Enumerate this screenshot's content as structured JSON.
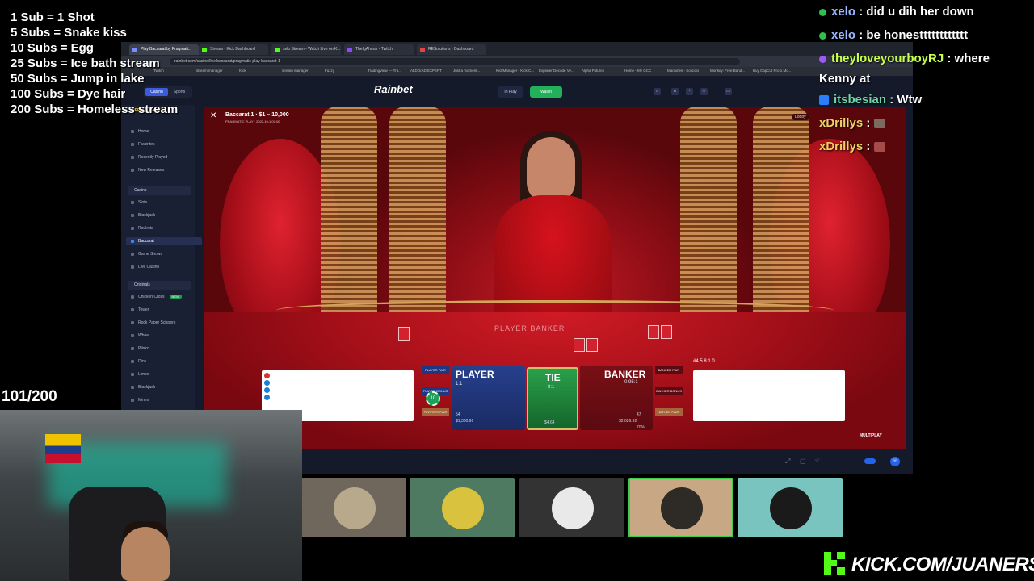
{
  "stream_overlay": {
    "sub_goals": [
      "1 Sub = 1 Shot",
      "5 Subs = Snake kiss",
      "10 Subs = Egg",
      "25 Subs = Ice bath stream",
      "50 Subs = Jump in lake",
      "100 Subs = Dye hair",
      "200 Subs = Homeless stream"
    ],
    "sub_counter": "101/200",
    "watermark": "KICK.COM/JUANERSSS"
  },
  "chat": {
    "messages": [
      {
        "user": "xelo",
        "text": ": did u dih her down",
        "user_color": "#9ab8ff",
        "badge": "#2fbf4a"
      },
      {
        "user": "xelo",
        "text": ": be honestttttttttttt",
        "user_color": "#9ab8ff",
        "badge": "#2fbf4a"
      },
      {
        "user": "theyloveyourboyRJ",
        "text": ": where",
        "user_color": "#c8ff4a",
        "badge": "#9b59f5"
      },
      {
        "user": "",
        "text": "Kenny at",
        "user_color": "#ffffff",
        "badge": ""
      },
      {
        "user": "itsbesian",
        "text": ": Wtw",
        "user_color": "#6fd6a6",
        "badge": "#2b7fff"
      },
      {
        "user": "xDrillys",
        "text": ":",
        "user_color": "#f0d060",
        "badge": ""
      },
      {
        "user": "xDrillys",
        "text": ":",
        "user_color": "#f0d060",
        "badge": ""
      }
    ]
  },
  "browser": {
    "tabs": [
      {
        "label": "Play Baccarat by Pragmati...",
        "color": "#7a8cff"
      },
      {
        "label": "Stream - Kick Dashboard",
        "color": "#53fc18"
      },
      {
        "label": "xelo Stream - Watch Live on K...",
        "color": "#53fc18"
      },
      {
        "label": "TheIgAhmar - Twitch",
        "color": "#9146ff"
      },
      {
        "label": "RESolutions - Dashboard",
        "color": "#e24545"
      }
    ],
    "url": "rainbet.com/casino/live/baccarat/pragmatic-play-baccarat-1",
    "bookmarks": [
      "Twitch",
      "stream manager",
      "Kick",
      "stream manager",
      "Fuzzy",
      "TradingView — Tra...",
      "ALDO/AD EXPERT",
      "Just a moment...",
      "KickManager - Kick C...",
      "Explorer Decode Ve...",
      "Alpha Futures",
      "Home - My GCC",
      "Machines - Solicolo",
      "Monkey: Free Band...",
      "Buy CapCut Pro 1 Mo..."
    ]
  },
  "site": {
    "logo": "Rainbet",
    "toggle": [
      "Casino",
      "Sports"
    ],
    "in_play": "In Play",
    "wallet": "Wallet",
    "sidebar": {
      "raffle": "WEEKLY RAFFLE",
      "items_top": [
        "Home",
        "Favorites",
        "Recently Played",
        "New Releases"
      ],
      "casino_head": "Casino",
      "casino_items": [
        "Slots",
        "Blackjack",
        "Roulette",
        "Baccarat",
        "Game Shows",
        "Live Casino"
      ],
      "originals_head": "Originals",
      "originals_items": [
        "Chicken Cross",
        "Tower",
        "Rock Paper Scissors",
        "Wheel",
        "Plinko",
        "Dice",
        "Limbo",
        "Blackjack",
        "Mines"
      ],
      "new_badge": "NEW"
    }
  },
  "game": {
    "title": "Baccarat 1 · $1 – 10,000",
    "provider": "PRAGMATIC PLAY · 2020-10-1 00:00",
    "lobby": "Lobby",
    "table_text": "PLAYER  BANKER",
    "player": {
      "label": "PLAYER",
      "odds": "1:1",
      "count": "54",
      "amount": "$1,300.96"
    },
    "tie": {
      "label": "TIE",
      "odds": "8:1",
      "amount": "$4.64"
    },
    "banker": {
      "label": "BANKER",
      "odds": "0.95:1",
      "count": "47",
      "amount": "$2,026.92",
      "pct": "70%"
    },
    "side_bets": {
      "player_pair": "PLAYER PAIR",
      "player_bonus": "PLAYER BONUS",
      "perfect_pair": "PERFECT PAIR",
      "banker_pair": "BANKER PAIR",
      "banker_bonus": "BANKER BONUS",
      "either_pair": "EITHER PAIR"
    },
    "chip_value": "10",
    "stats": "#4  5  8  1  0",
    "multiplay": "MULTIPLAY"
  },
  "colors": {
    "kick_green": "#53fc18",
    "wallet_green": "#22b05a",
    "player_blue": "#27408d",
    "tie_green": "#29a04a",
    "banker_red": "#7a0f16"
  },
  "participants": [
    {
      "bg": "#6f675c",
      "ava": "#b8a98c",
      "icon": "group-photo-avatar"
    },
    {
      "bg": "#4e7a62",
      "ava": "#d8c23e",
      "icon": "person-avatar"
    },
    {
      "bg": "#333333",
      "ava": "#e9e9e9",
      "icon": "fish-avatar"
    },
    {
      "bg": "#c8a784",
      "ava": "#2e2a26",
      "icon": "baby-avatar"
    },
    {
      "bg": "#79c4be",
      "ava": "#1a1a1a",
      "icon": "person-avatar"
    }
  ]
}
